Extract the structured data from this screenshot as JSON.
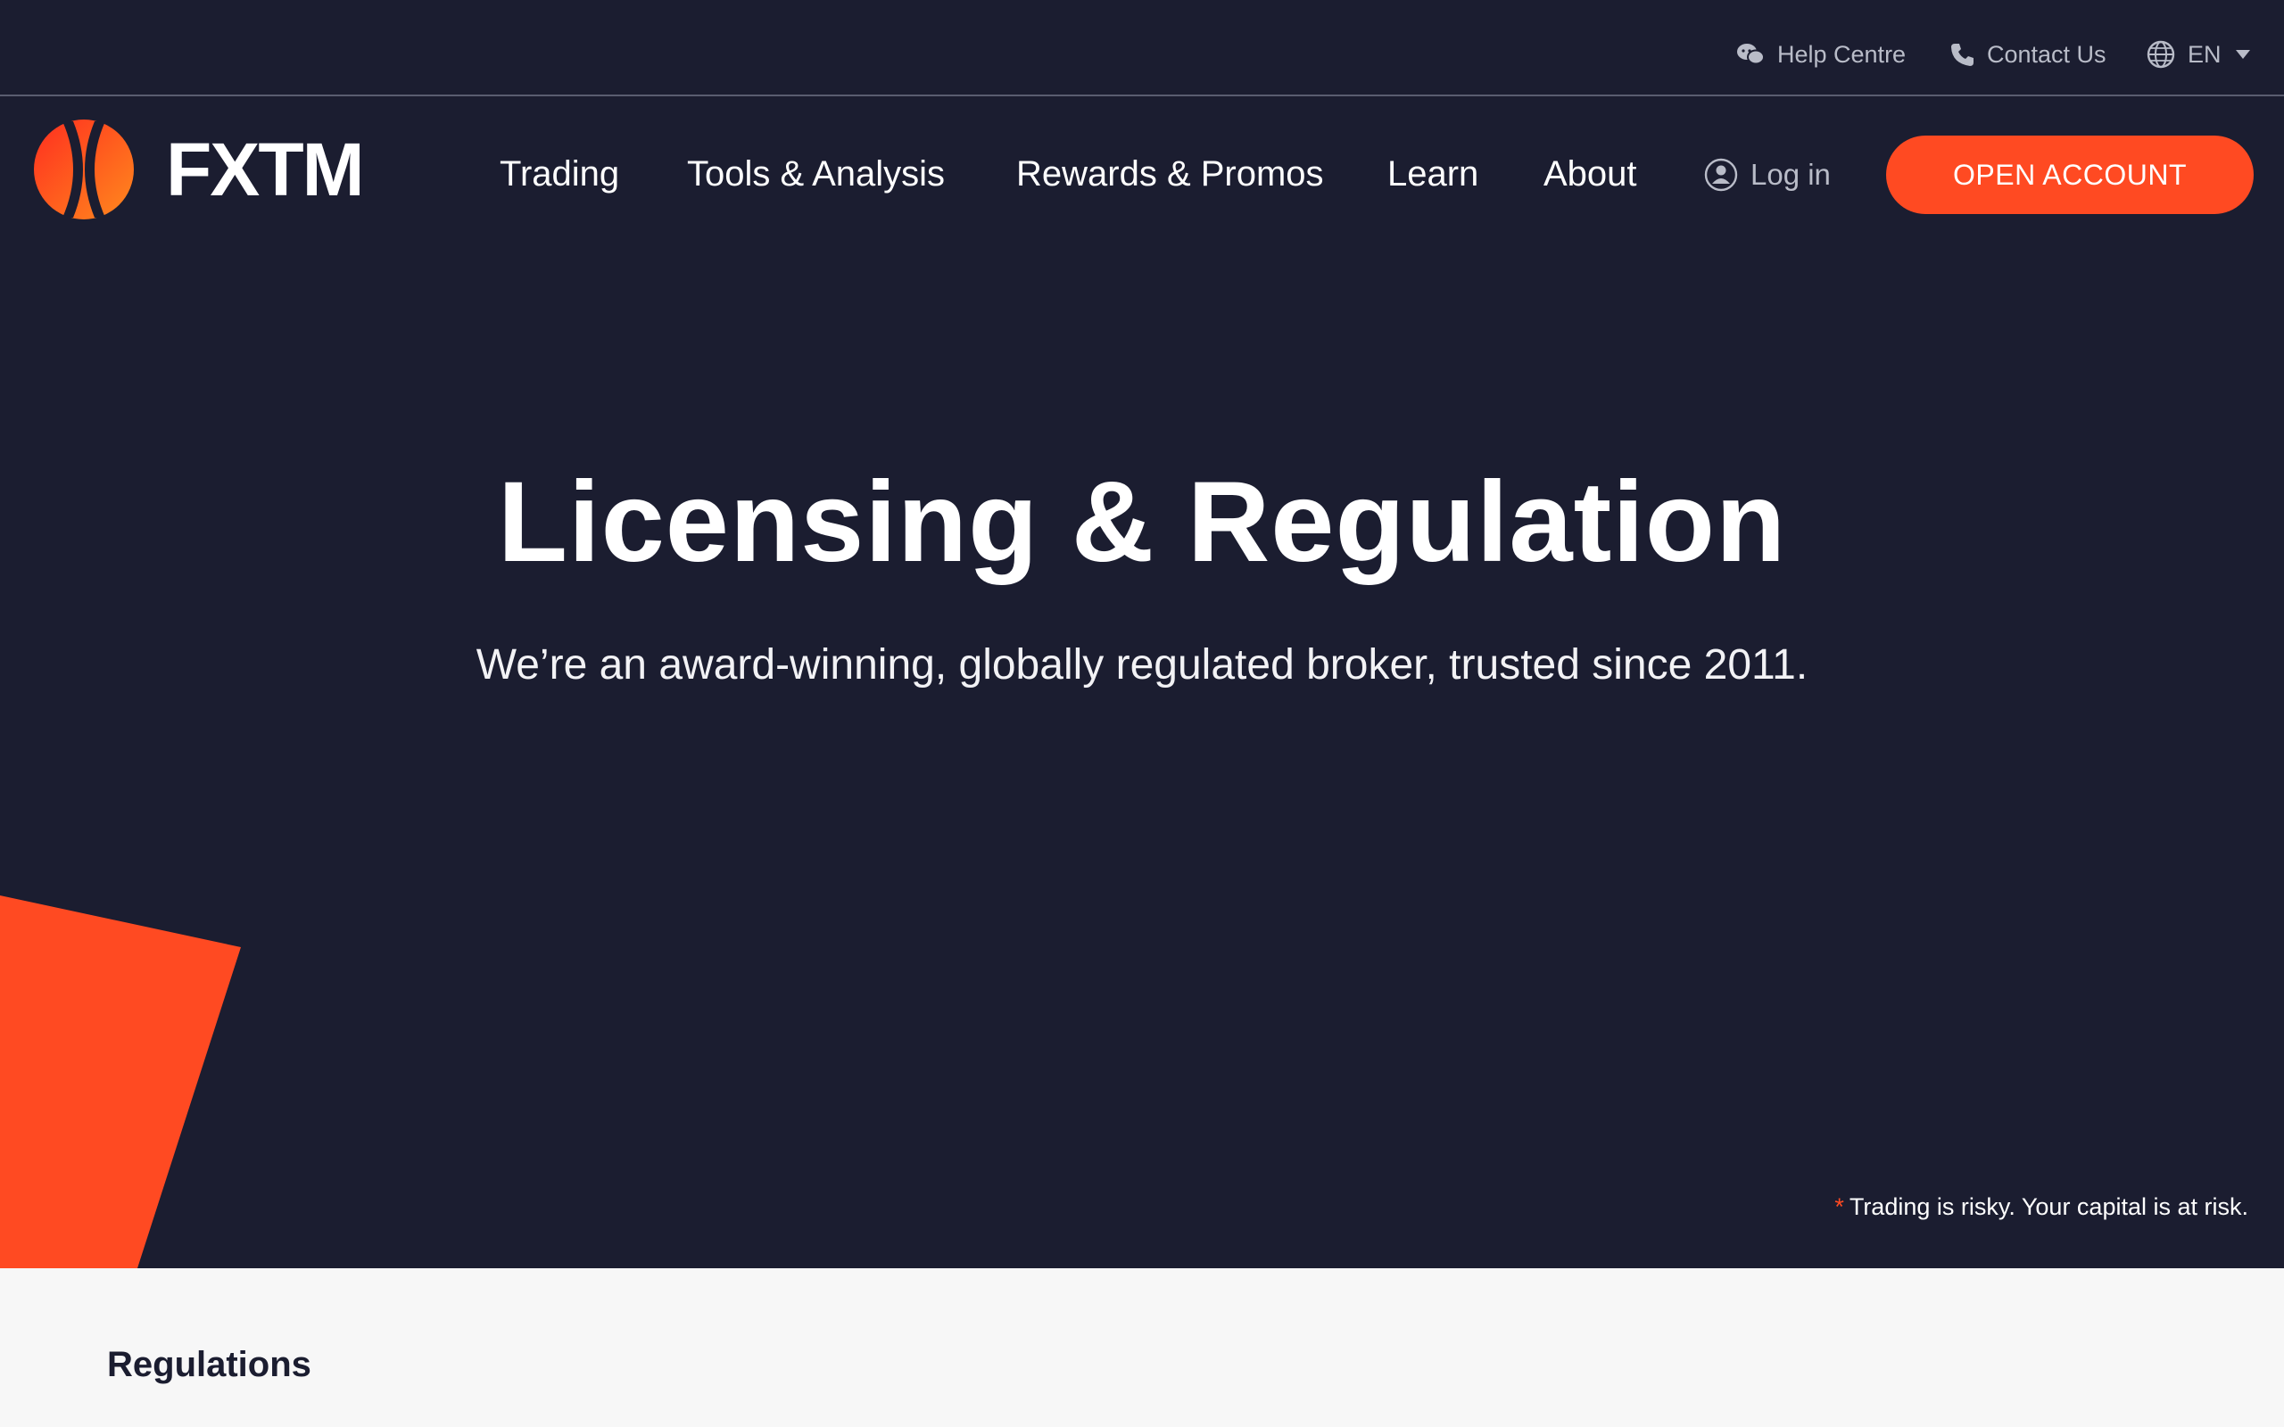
{
  "topbar": {
    "help_label": "Help Centre",
    "contact_label": "Contact Us",
    "lang_label": "EN"
  },
  "brand": {
    "name": "FXTM",
    "accent": "#ff4a22",
    "background": "#1b1d30"
  },
  "nav": {
    "items": [
      {
        "label": "Trading"
      },
      {
        "label": "Tools & Analysis"
      },
      {
        "label": "Rewards & Promos"
      },
      {
        "label": "Learn"
      },
      {
        "label": "About"
      }
    ],
    "login_label": "Log in",
    "cta_label": "OPEN ACCOUNT"
  },
  "hero": {
    "title": "Licensing & Regulation",
    "subtitle": "We’re an award-winning, globally regulated broker, trusted since 2011.",
    "risk_marker": "*",
    "risk_text": "Trading is risky. Your capital is at risk."
  },
  "section": {
    "heading": "Regulations"
  },
  "icons": [
    "chat-bubbles-icon",
    "phone-icon",
    "globe-icon",
    "caret-down-icon",
    "user-icon",
    "fxtm-logo-icon"
  ]
}
